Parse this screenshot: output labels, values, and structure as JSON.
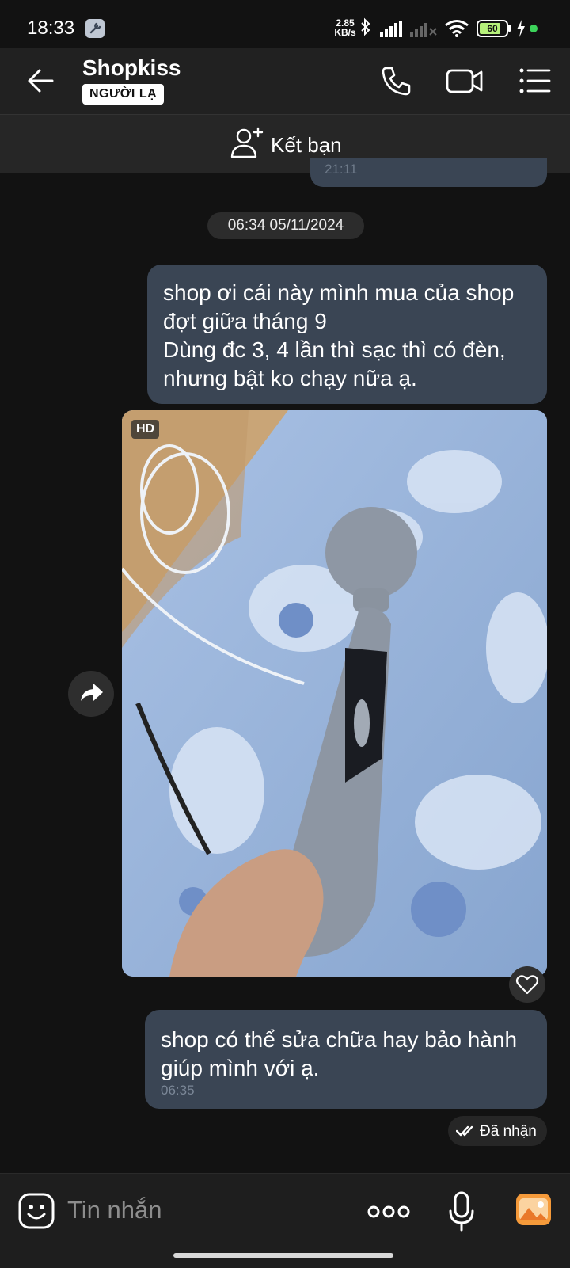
{
  "status_bar": {
    "time": "18:33",
    "net_speed_value": "2.85",
    "net_speed_unit": "KB/s",
    "battery": "60"
  },
  "header": {
    "title": "Shopkiss",
    "badge": "NGƯỜI LẠ",
    "add_friend_label": "Kết bạn"
  },
  "chat": {
    "previous_time_partial": "21:11",
    "date_separator": "06:34 05/11/2024",
    "message1_lines": [
      "shop ơi cái này mình mua của shop",
      "đợt giữa tháng 9",
      "Dùng đc 3, 4 lần thì sạc thì có đèn,",
      "nhưng bật ko chạy nữa ạ."
    ],
    "photo_badge": "HD",
    "message2_lines": [
      "shop có thể sửa chữa hay bảo hành",
      "giúp mình với ạ."
    ],
    "message2_time": "06:35",
    "receipt_status": "Đã nhận"
  },
  "input": {
    "placeholder": "Tin nhắn"
  },
  "icons": {
    "back": "back-arrow-icon",
    "call": "phone-icon",
    "video": "video-camera-icon",
    "menu": "list-menu-icon",
    "add_friend": "add-person-icon",
    "share": "share-forward-icon",
    "like": "heart-icon",
    "emoji": "sticker-smile-icon",
    "more": "more-dots-icon",
    "mic": "microphone-icon",
    "gallery": "image-gallery-icon"
  },
  "colors": {
    "bubble": "#3a4554",
    "gallery_accent": "#f59a3a",
    "battery_fill": "#b6f07a"
  }
}
